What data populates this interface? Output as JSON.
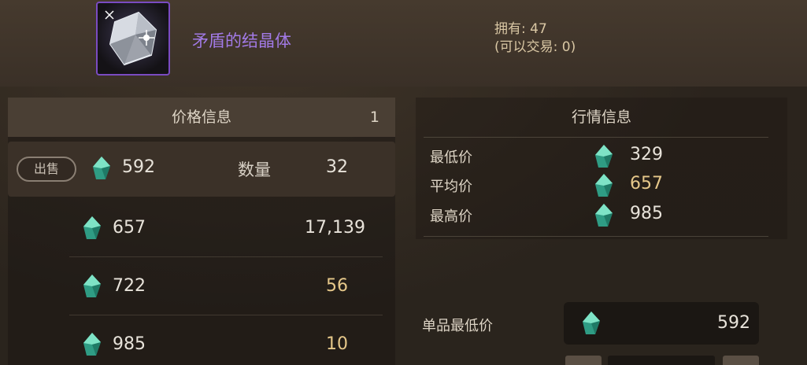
{
  "item": {
    "name": "矛盾的结晶体",
    "owned": "拥有: 47",
    "tradable": "(可以交易: 0)",
    "icon": "crystal-icon"
  },
  "price_panel": {
    "title": "价格信息",
    "count": "1",
    "sell_label": "出售",
    "qty_label": "数量",
    "rows": [
      {
        "price": "592",
        "qty": "32"
      },
      {
        "price": "657",
        "qty": "17,139"
      },
      {
        "price": "722",
        "qty": "56"
      },
      {
        "price": "985",
        "qty": "10"
      }
    ]
  },
  "market_panel": {
    "title": "行情信息",
    "stats": [
      {
        "label": "最低价",
        "value": "329"
      },
      {
        "label": "平均价",
        "value": "657"
      },
      {
        "label": "最高价",
        "value": "985"
      }
    ]
  },
  "unit_price": {
    "label": "单品最低价",
    "value": "592"
  },
  "colors": {
    "accent_purple": "#a27ae6",
    "gold": "#e6c88a",
    "gem": "#3fc3a1"
  }
}
